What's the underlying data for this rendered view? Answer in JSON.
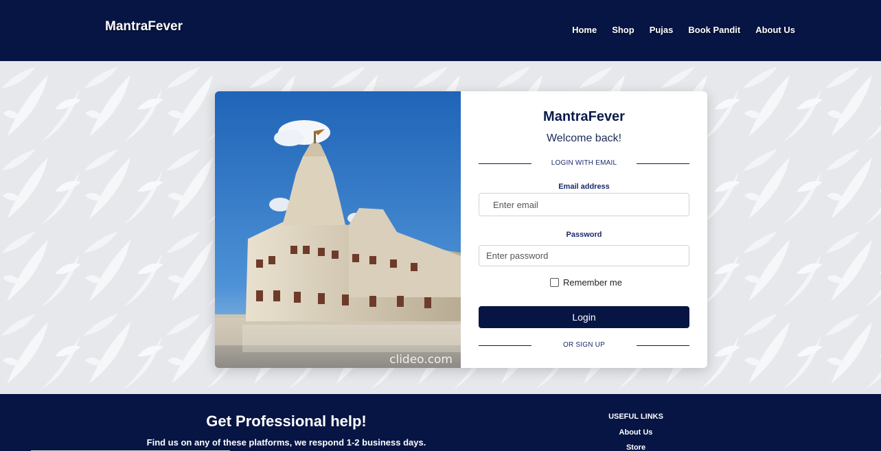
{
  "navbar": {
    "brand": "MantraFever",
    "links": [
      "Home",
      "Shop",
      "Pujas",
      "Book Pandit",
      "About Us"
    ]
  },
  "login_card": {
    "photo_watermark": "clideo.com",
    "brand": "MantraFever",
    "welcome": "Welcome back!",
    "divider_login": "LOGIN WITH EMAIL",
    "email_label": "Email address",
    "email_placeholder": "Enter email",
    "email_value": "",
    "password_label": "Password",
    "password_placeholder": "Enter password",
    "password_value": "",
    "remember_label": "Remember me",
    "remember_checked": false,
    "login_button": "Login",
    "divider_signup": "OR SIGN UP"
  },
  "footer": {
    "help_title": "Get Professional help!",
    "help_subtitle": "Find us on any of these platforms, we respond 1-2 business days.",
    "useful_links_title": "USEFUL LINKS",
    "useful_links": [
      "About Us",
      "Store"
    ]
  },
  "colors": {
    "navy": "#071544",
    "page_bg": "#e9ebef",
    "card_bg": "#ffffff"
  }
}
